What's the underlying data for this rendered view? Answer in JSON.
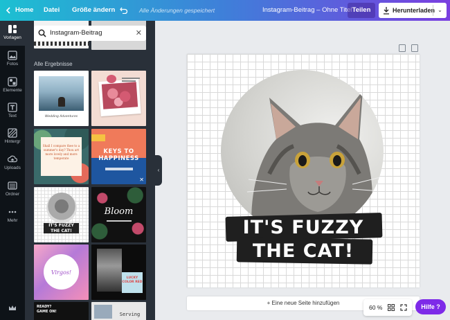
{
  "topbar": {
    "home_label": "Home",
    "file_label": "Datei",
    "resize_label": "Größe ändern",
    "saved_status": "Alle Änderungen gespeichert",
    "document_title": "Instagram-Beitrag – Ohne Titel",
    "share_label": "Teilen",
    "download_label": "Herunterladen"
  },
  "rail": {
    "items": [
      {
        "label": "Vorlagen",
        "icon": "templates-icon",
        "active": true
      },
      {
        "label": "Fotos",
        "icon": "photos-icon"
      },
      {
        "label": "Elemente",
        "icon": "elements-icon"
      },
      {
        "label": "Text",
        "icon": "text-icon"
      },
      {
        "label": "Hintergr",
        "icon": "background-icon"
      },
      {
        "label": "Uploads",
        "icon": "uploads-icon"
      },
      {
        "label": "Ordner",
        "icon": "folder-icon"
      },
      {
        "label": "Mehr",
        "icon": "more-icon"
      }
    ]
  },
  "panel": {
    "search_value": "Instagram-Beitrag",
    "results_label": "Alle Ergebnisse",
    "templates": [
      {
        "text": "Wedding Adventures"
      },
      {
        "text": ""
      },
      {
        "text": "Shall I compare thee to a summer's day? Thou art more lovely and more temperate"
      },
      {
        "text": "KEYS TO HAPPINESS"
      },
      {
        "text": "IT'S FUZZY THE CAT!"
      },
      {
        "text": "Bloom"
      },
      {
        "text": "Virgos!"
      },
      {
        "text": "LUCKY COLOR RED"
      },
      {
        "text": "READY? GAME ON!"
      },
      {
        "text": "Serving"
      }
    ]
  },
  "design": {
    "headline_line1": "IT'S FUZZY",
    "headline_line2": "THE CAT!"
  },
  "footer": {
    "add_page_label": "+ Eine neue Seite hinzufügen",
    "zoom_value": "60 %",
    "help_label": "Hilfe ?"
  },
  "colors": {
    "accent_purple": "#7d2ae8",
    "panel_bg": "#293039",
    "rail_bg": "#0e1318"
  }
}
